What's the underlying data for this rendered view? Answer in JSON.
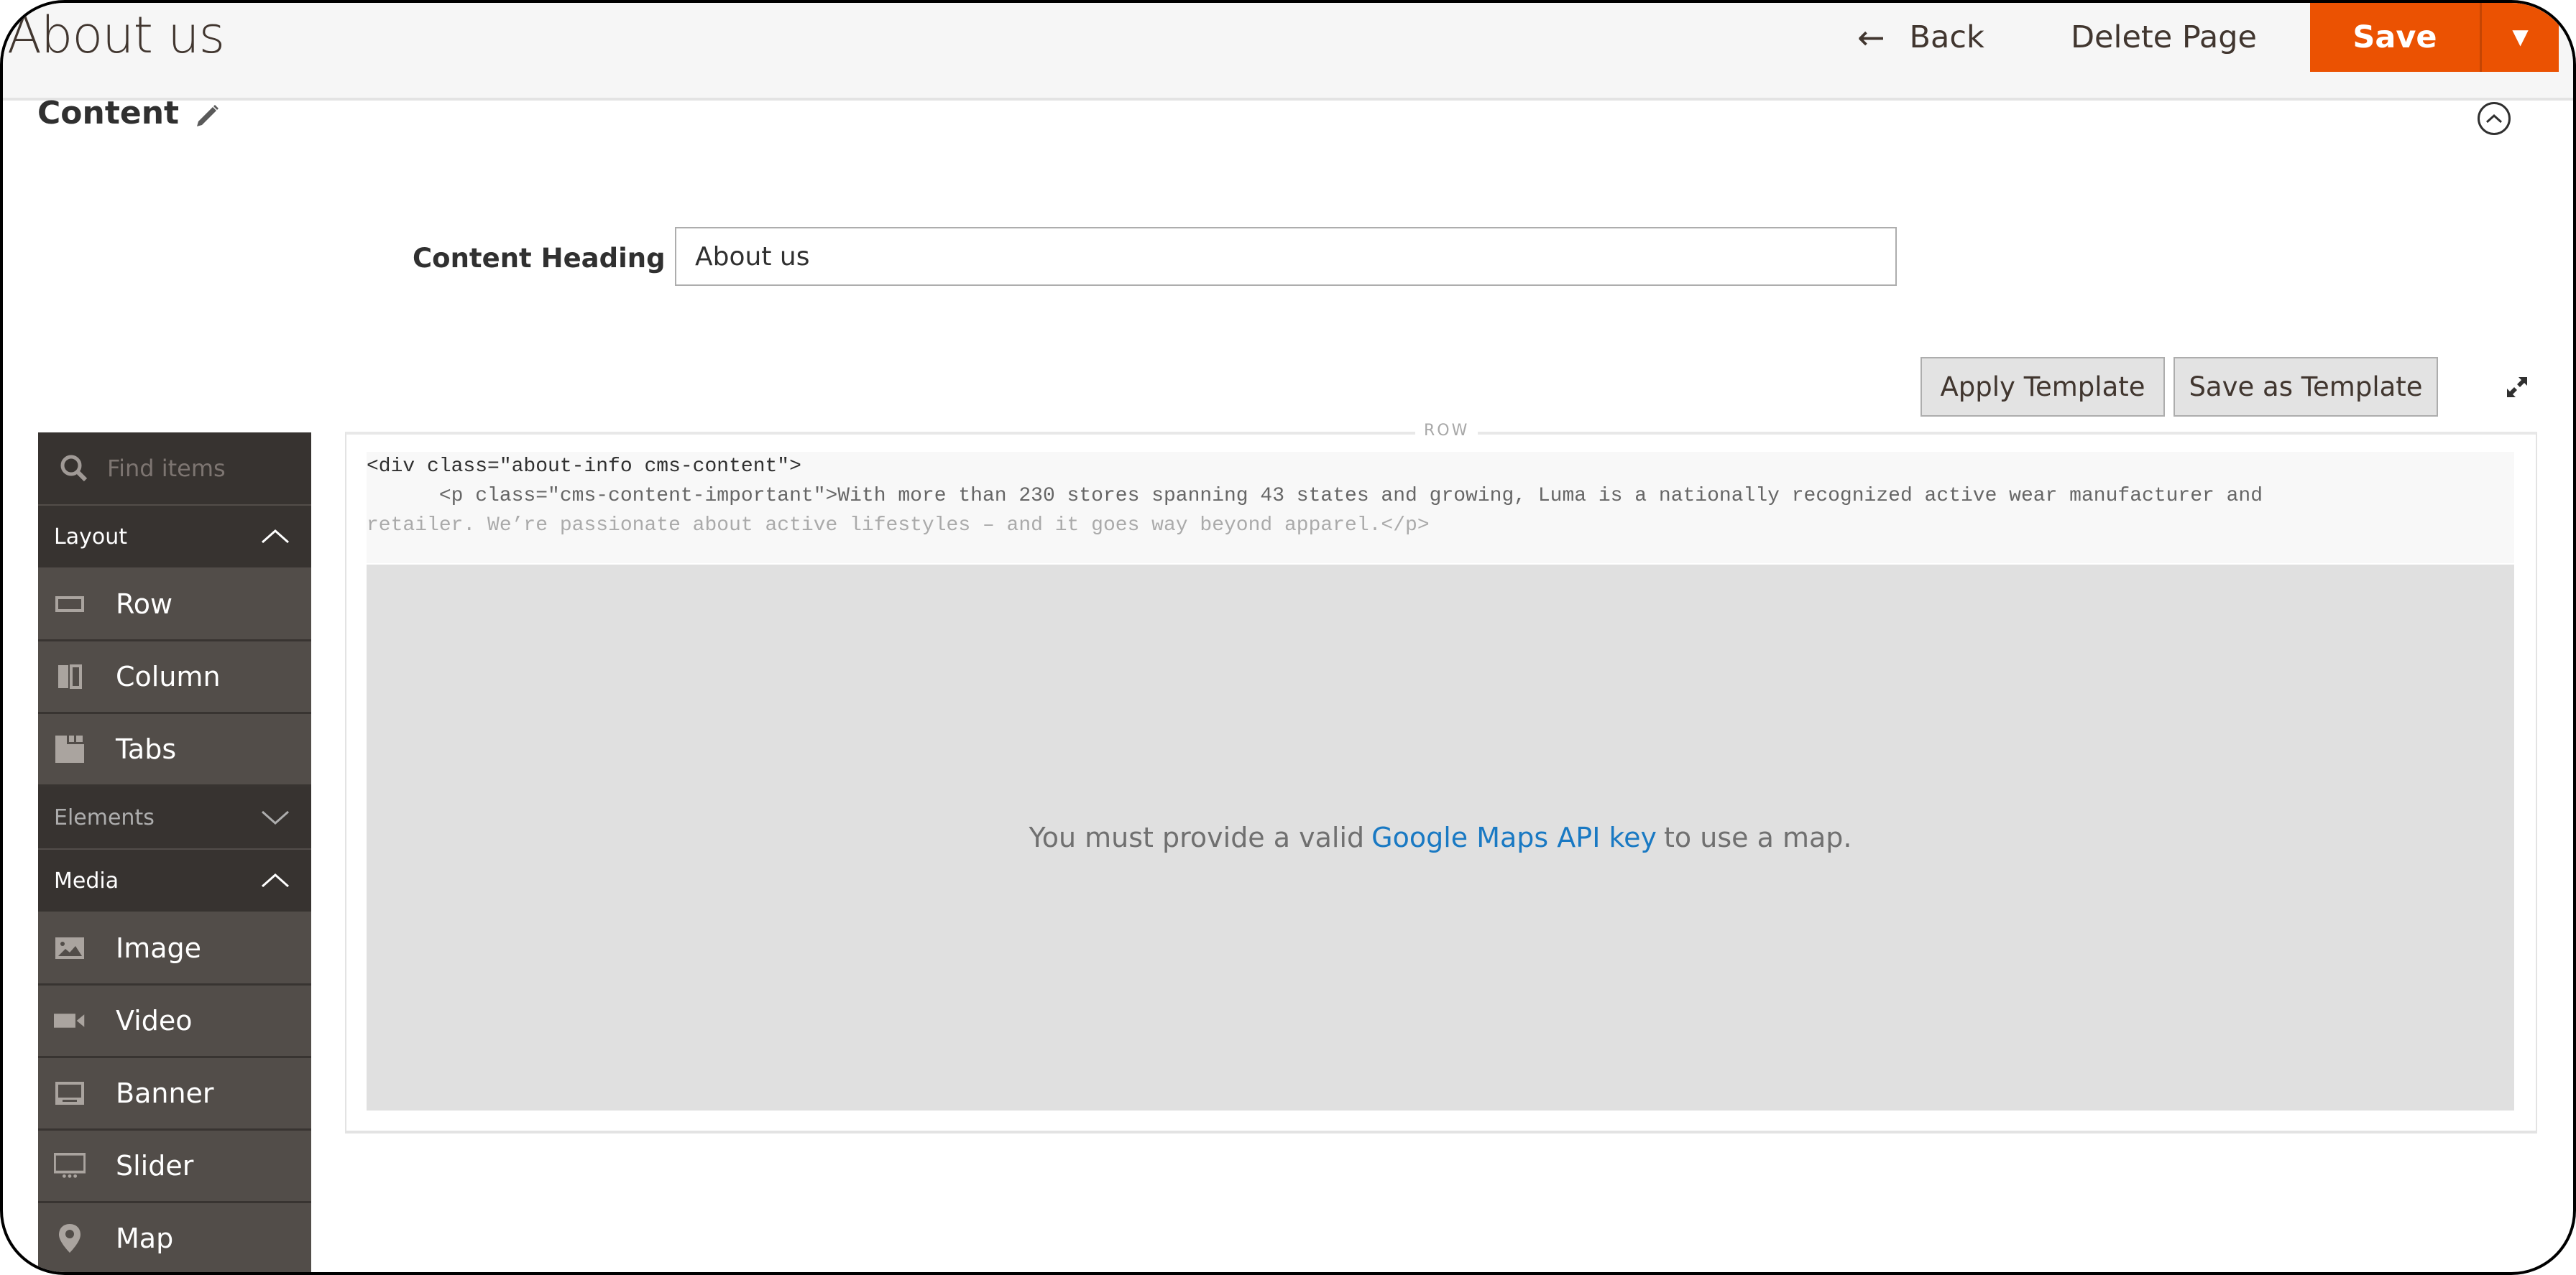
{
  "header": {
    "title": "About us",
    "back_label": "Back",
    "back_icon": "arrow-left-icon",
    "delete_label": "Delete Page",
    "save_label": "Save",
    "save_split_icon": "triangle-down-icon",
    "accent_color": "#eb5202"
  },
  "section": {
    "title": "Content",
    "edit_icon": "pencil-icon",
    "collapse_icon": "chevron-up-circle-icon"
  },
  "form": {
    "content_heading_label": "Content Heading",
    "content_heading_value": "About us"
  },
  "toolbar": {
    "apply_template_label": "Apply Template",
    "save_as_template_label": "Save as Template",
    "fullscreen_icon": "expand-icon"
  },
  "sidebar": {
    "search_placeholder": "Find items",
    "groups": [
      {
        "label": "Layout",
        "expanded": true,
        "items": [
          {
            "label": "Row",
            "icon": "row-icon"
          },
          {
            "label": "Column",
            "icon": "column-icon"
          },
          {
            "label": "Tabs",
            "icon": "tabs-icon"
          }
        ]
      },
      {
        "label": "Elements",
        "expanded": false,
        "items": []
      },
      {
        "label": "Media",
        "expanded": true,
        "items": [
          {
            "label": "Image",
            "icon": "image-icon"
          },
          {
            "label": "Video",
            "icon": "video-icon"
          },
          {
            "label": "Banner",
            "icon": "banner-icon"
          },
          {
            "label": "Slider",
            "icon": "slider-icon"
          },
          {
            "label": "Map",
            "icon": "map-pin-icon"
          }
        ]
      }
    ]
  },
  "stage": {
    "row_label": "ROW",
    "code_lines": [
      "<div class=\"about-info cms-content\">",
      "      <p class=\"cms-content-important\">With more than 230 stores spanning 43 states and growing, Luma is a nationally recognized active wear manufacturer and",
      "retailer. We’re passionate about active lifestyles – and it goes way beyond apparel.</p>"
    ],
    "map_message_before": "You must provide a valid",
    "map_message_link": "Google Maps API key",
    "map_message_after": "to use a map."
  }
}
